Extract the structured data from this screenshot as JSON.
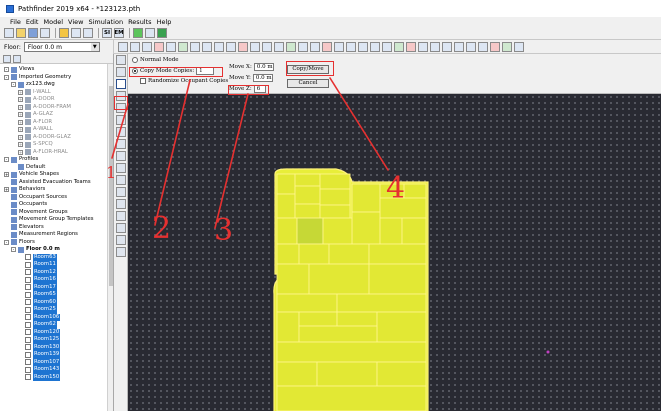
{
  "window": {
    "title": "Pathfinder 2019 x64 - *123123.pth"
  },
  "menu": [
    "File",
    "Edit",
    "Model",
    "View",
    "Simulation",
    "Results",
    "Help"
  ],
  "toolbar": {
    "si_label": "SI",
    "em_label": "EM"
  },
  "floor_selector": {
    "label": "Floor:",
    "value": "Floor 0.0 m"
  },
  "navigator": {
    "items": [
      {
        "label": "Views",
        "level": 0,
        "expand": "-",
        "style": "normal"
      },
      {
        "label": "Imported Geometry",
        "level": 0,
        "expand": "-",
        "style": "normal"
      },
      {
        "label": "zx123.dwg",
        "level": 1,
        "expand": "-",
        "style": "normal"
      },
      {
        "label": "I-WALL",
        "level": 2,
        "expand": "+",
        "style": "grey"
      },
      {
        "label": "A-DOOR",
        "level": 2,
        "expand": "+",
        "style": "grey"
      },
      {
        "label": "A-DOOR-FRAM",
        "level": 2,
        "expand": "+",
        "style": "grey"
      },
      {
        "label": "A-GLAZ",
        "level": 2,
        "expand": "+",
        "style": "grey"
      },
      {
        "label": "A-FLOR",
        "level": 2,
        "expand": "+",
        "style": "grey"
      },
      {
        "label": "A-WALL",
        "level": 2,
        "expand": "+",
        "style": "grey"
      },
      {
        "label": "A-DOOR-GLAZ",
        "level": 2,
        "expand": "+",
        "style": "grey"
      },
      {
        "label": "S-SPCQ",
        "level": 2,
        "expand": "+",
        "style": "grey"
      },
      {
        "label": "A-FLOR-HRAL",
        "level": 2,
        "expand": "+",
        "style": "grey"
      },
      {
        "label": "Profiles",
        "level": 0,
        "expand": "-",
        "style": "normal"
      },
      {
        "label": "Default",
        "level": 1,
        "expand": "",
        "style": "normal"
      },
      {
        "label": "Vehicle Shapes",
        "level": 0,
        "expand": "+",
        "style": "normal"
      },
      {
        "label": "Assisted Evacuation Teams",
        "level": 0,
        "expand": "",
        "style": "normal"
      },
      {
        "label": "Behaviors",
        "level": 0,
        "expand": "+",
        "style": "normal"
      },
      {
        "label": "Occupant Sources",
        "level": 0,
        "expand": "",
        "style": "normal"
      },
      {
        "label": "Occupants",
        "level": 0,
        "expand": "",
        "style": "normal"
      },
      {
        "label": "Movement Groups",
        "level": 0,
        "expand": "",
        "style": "normal"
      },
      {
        "label": "Movement Group Templates",
        "level": 0,
        "expand": "",
        "style": "normal"
      },
      {
        "label": "Elevators",
        "level": 0,
        "expand": "",
        "style": "normal"
      },
      {
        "label": "Measurement Regions",
        "level": 0,
        "expand": "",
        "style": "normal"
      },
      {
        "label": "Floors",
        "level": 0,
        "expand": "-",
        "style": "normal"
      },
      {
        "label": "Floor 0.0 m",
        "level": 1,
        "expand": "-",
        "style": "bold"
      },
      {
        "label": "Room63",
        "level": 2,
        "expand": "",
        "style": "sel"
      },
      {
        "label": "Room11",
        "level": 2,
        "expand": "",
        "style": "sel"
      },
      {
        "label": "Room12",
        "level": 2,
        "expand": "",
        "style": "sel"
      },
      {
        "label": "Room16",
        "level": 2,
        "expand": "",
        "style": "sel"
      },
      {
        "label": "Room17",
        "level": 2,
        "expand": "",
        "style": "sel"
      },
      {
        "label": "Room65",
        "level": 2,
        "expand": "",
        "style": "sel"
      },
      {
        "label": "Room60",
        "level": 2,
        "expand": "",
        "style": "sel"
      },
      {
        "label": "Room25",
        "level": 2,
        "expand": "",
        "style": "sel"
      },
      {
        "label": "Room106",
        "level": 2,
        "expand": "",
        "style": "sel"
      },
      {
        "label": "Room62",
        "level": 2,
        "expand": "",
        "style": "sel"
      },
      {
        "label": "Room120",
        "level": 2,
        "expand": "",
        "style": "sel"
      },
      {
        "label": "Room125",
        "level": 2,
        "expand": "",
        "style": "sel"
      },
      {
        "label": "Room130",
        "level": 2,
        "expand": "",
        "style": "sel"
      },
      {
        "label": "Room139",
        "level": 2,
        "expand": "",
        "style": "sel"
      },
      {
        "label": "Room107",
        "level": 2,
        "expand": "",
        "style": "sel"
      },
      {
        "label": "Room143",
        "level": 2,
        "expand": "",
        "style": "sel"
      },
      {
        "label": "Room150",
        "level": 2,
        "expand": "",
        "style": "sel"
      }
    ]
  },
  "copy_panel": {
    "normal_mode": "Normal Mode",
    "copy_mode": "Copy Mode Copies:",
    "copies_value": "1",
    "randomize_label": "Randomize Occupant Copies",
    "move_x_label": "Move X:",
    "move_x_value": "0.0 m",
    "move_y_label": "Move Y:",
    "move_y_value": "0.0 m",
    "move_z_label": "Move Z:",
    "move_z_value": "6",
    "copy_move_button": "Copy/Move",
    "cancel_button": "Cancel"
  },
  "annotations": {
    "one": "1",
    "two": "2",
    "three": "3",
    "four": "4"
  },
  "colors": {
    "selection": "#1e74d1",
    "room_fill": "#e8ee39",
    "room_edge": "#fff27a",
    "canvas_bg": "#292a32",
    "annotation": "#e53030"
  }
}
